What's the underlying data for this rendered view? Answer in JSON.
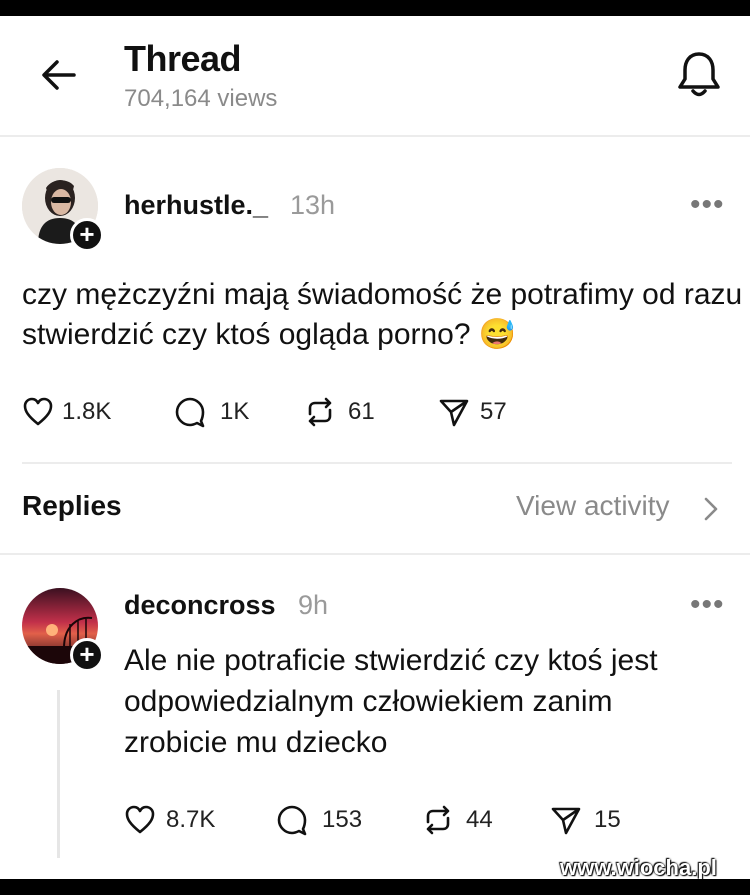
{
  "header": {
    "title": "Thread",
    "views": "704,164 views"
  },
  "post": {
    "username": "herhustle._",
    "time": "13h",
    "more": "•••",
    "text": "czy mężczyźni mają świadomość że potrafimy od razu stwierdzić czy ktoś ogląda porno? 😅",
    "stats": {
      "likes": "1.8K",
      "comments": "1K",
      "reposts": "61",
      "shares": "57"
    }
  },
  "replies_bar": {
    "label": "Replies",
    "view_activity": "View activity"
  },
  "reply": {
    "username": "deconcross",
    "time": "9h",
    "more": "•••",
    "text": "Ale nie potraficie stwierdzić czy ktoś jest odpowiedzialnym człowiekiem zanim zrobicie mu dziecko",
    "stats": {
      "likes": "8.7K",
      "comments": "153",
      "reposts": "44",
      "shares": "15"
    }
  },
  "plus_glyph": "+",
  "watermark": "www.wiocha.pl",
  "icons": [
    "back-arrow-icon",
    "bell-icon",
    "heart-icon",
    "comment-icon",
    "repost-icon",
    "share-icon",
    "chevron-right-icon"
  ]
}
